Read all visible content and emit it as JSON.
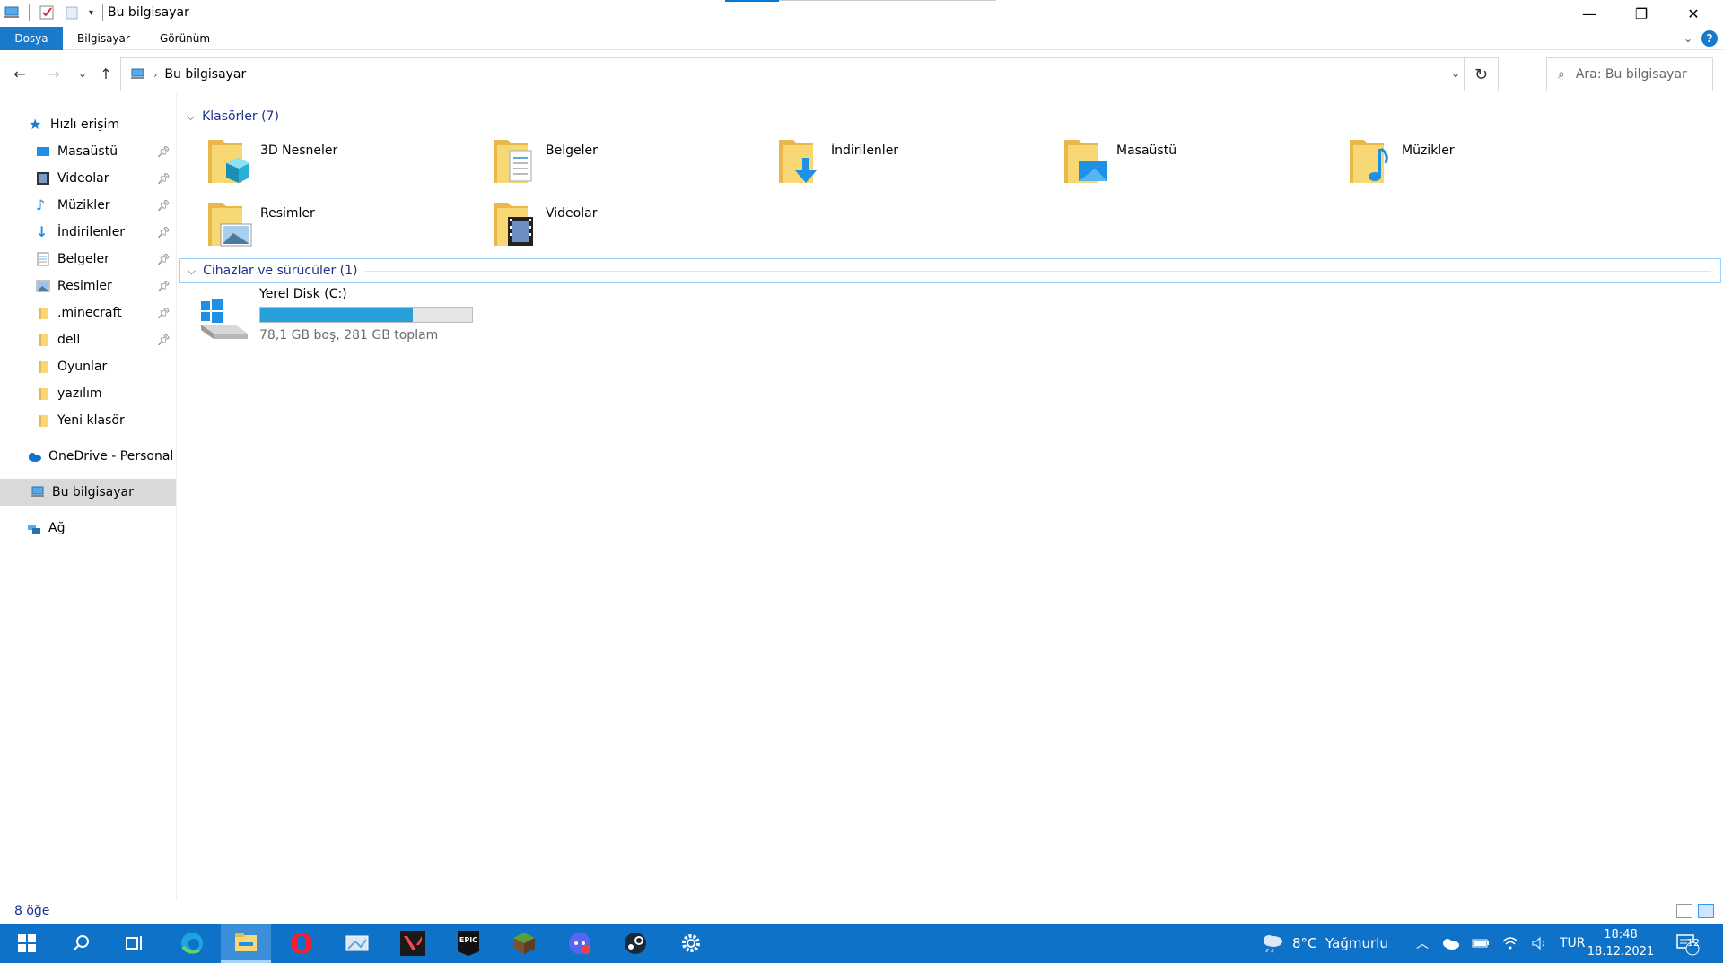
{
  "window": {
    "title": "Bu bilgisayar",
    "minimize_label": "—",
    "restore_label": "❐",
    "close_label": "✕"
  },
  "ribbon": {
    "tabs": [
      "Dosya",
      "Bilgisayar",
      "Görünüm"
    ],
    "help_label": "?"
  },
  "navigation": {
    "back_label": "←",
    "forward_label": "→",
    "recent_label": "⌄",
    "up_label": "↑",
    "address_path": "Bu bilgisayar",
    "refresh_label": "↻",
    "search_placeholder": "Ara: Bu bilgisayar"
  },
  "sidebar": {
    "quick_access_label": "Hızlı erişim",
    "quick_items": [
      {
        "label": "Masaüstü",
        "icon": "desktop-icon",
        "pinned": true
      },
      {
        "label": "Videolar",
        "icon": "videos-icon",
        "pinned": true
      },
      {
        "label": "Müzikler",
        "icon": "music-icon",
        "pinned": true
      },
      {
        "label": "İndirilenler",
        "icon": "download-icon",
        "pinned": true
      },
      {
        "label": "Belgeler",
        "icon": "documents-icon",
        "pinned": true
      },
      {
        "label": "Resimler",
        "icon": "pictures-icon",
        "pinned": true
      },
      {
        "label": ".minecraft",
        "icon": "folder-icon",
        "pinned": true
      },
      {
        "label": "dell",
        "icon": "folder-icon",
        "pinned": true
      },
      {
        "label": "Oyunlar",
        "icon": "folder-icon",
        "pinned": false
      },
      {
        "label": "yazılım",
        "icon": "folder-icon",
        "pinned": false
      },
      {
        "label": "Yeni klasör",
        "icon": "folder-icon",
        "pinned": false
      }
    ],
    "onedrive_label": "OneDrive - Personal",
    "thispc_label": "Bu bilgisayar",
    "network_label": "Ağ"
  },
  "main": {
    "folders_header": "Klasörler (7)",
    "folders": [
      {
        "label": "3D Nesneler",
        "icon": "3d-objects-icon"
      },
      {
        "label": "Belgeler",
        "icon": "documents-icon"
      },
      {
        "label": "İndirilenler",
        "icon": "download-icon"
      },
      {
        "label": "Masaüstü",
        "icon": "desktop-icon"
      },
      {
        "label": "Müzikler",
        "icon": "music-icon"
      },
      {
        "label": "Resimler",
        "icon": "pictures-icon"
      },
      {
        "label": "Videolar",
        "icon": "videos-icon"
      }
    ],
    "devices_header": "Cihazlar ve sürücüler (1)",
    "drive": {
      "label": "Yerel Disk (C:)",
      "info": "78,1 GB boş, 281 GB toplam",
      "free_gb": 78.1,
      "total_gb": 281
    }
  },
  "status": {
    "count": "8 öğe"
  },
  "taskbar": {
    "weather": "8°C  Yağmurlu",
    "language": "TUR",
    "time": "18:48",
    "date": "18.12.2021",
    "notification_count": "12"
  },
  "colors": {
    "accent": "#1979ca",
    "taskbar": "#0f72c9",
    "link": "#1e3287",
    "drive_bar": "#26a0da",
    "folder": "#f8d775"
  }
}
